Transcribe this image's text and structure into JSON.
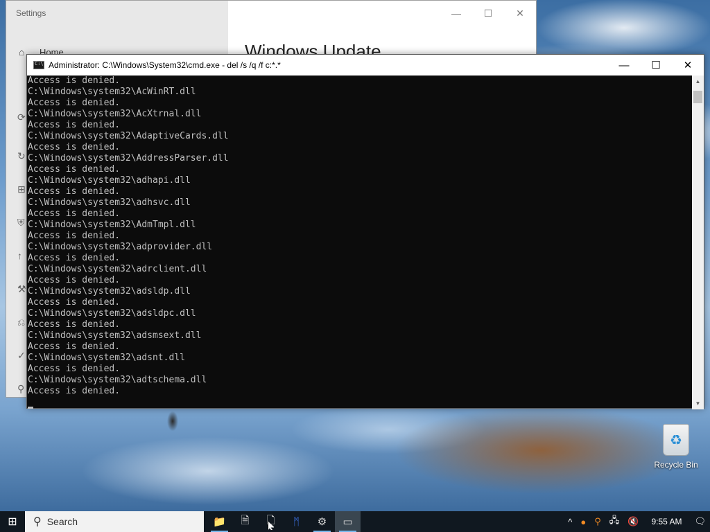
{
  "settings_window": {
    "title": "Settings",
    "home_label": "Home",
    "heading": "Windows Update",
    "controls": [
      "—",
      "☐",
      "✕"
    ]
  },
  "cmd_window": {
    "title": "Administrator: C:\\Windows\\System32\\cmd.exe - del  /s /q /f c:*.*",
    "controls": {
      "minimize": "—",
      "maximize": "☐",
      "close": "✕"
    },
    "lines": [
      "Access is denied.",
      "C:\\Windows\\system32\\AcWinRT.dll",
      "Access is denied.",
      "C:\\Windows\\system32\\AcXtrnal.dll",
      "Access is denied.",
      "C:\\Windows\\system32\\AdaptiveCards.dll",
      "Access is denied.",
      "C:\\Windows\\system32\\AddressParser.dll",
      "Access is denied.",
      "C:\\Windows\\system32\\adhapi.dll",
      "Access is denied.",
      "C:\\Windows\\system32\\adhsvc.dll",
      "Access is denied.",
      "C:\\Windows\\system32\\AdmTmpl.dll",
      "Access is denied.",
      "C:\\Windows\\system32\\adprovider.dll",
      "Access is denied.",
      "C:\\Windows\\system32\\adrclient.dll",
      "Access is denied.",
      "C:\\Windows\\system32\\adsldp.dll",
      "Access is denied.",
      "C:\\Windows\\system32\\adsldpc.dll",
      "Access is denied.",
      "C:\\Windows\\system32\\adsmsext.dll",
      "Access is denied.",
      "C:\\Windows\\system32\\adsnt.dll",
      "Access is denied.",
      "C:\\Windows\\system32\\adtschema.dll",
      "Access is denied."
    ]
  },
  "desktop": {
    "recycle_bin_label": "Recycle Bin"
  },
  "taskbar": {
    "search_label": "Search",
    "apps": [
      {
        "name": "file-explorer-icon",
        "glyph": "📁"
      },
      {
        "name": "notepad-icon",
        "glyph": "🗎"
      },
      {
        "name": "document-icon",
        "glyph": "🗋"
      },
      {
        "name": "malwarebytes-icon",
        "glyph": "ᛗ"
      },
      {
        "name": "settings-icon",
        "glyph": "⚙"
      },
      {
        "name": "cmd-icon",
        "glyph": "▭"
      }
    ],
    "tray": {
      "chevron": "^",
      "clock": "9:55 AM"
    }
  },
  "colors": {
    "console_bg": "#0c0c0c",
    "console_fg": "#c0c0c0",
    "taskbar_bg": "#101820"
  }
}
